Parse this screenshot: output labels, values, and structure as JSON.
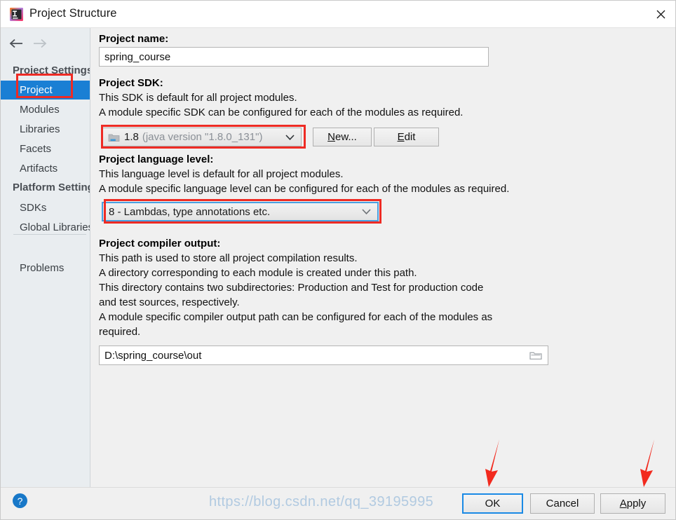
{
  "window": {
    "title": "Project Structure",
    "app_icon": "intellij-idea-icon",
    "close_label": "✕"
  },
  "sidebar": {
    "back_icon": "arrow-left-icon",
    "forward_icon": "arrow-right-icon",
    "groups": [
      {
        "label": "Project Settings"
      },
      {
        "label": "Platform Settings"
      }
    ],
    "items": [
      {
        "label": "Project",
        "selected": true
      },
      {
        "label": "Modules",
        "selected": false
      },
      {
        "label": "Libraries",
        "selected": false
      },
      {
        "label": "Facets",
        "selected": false
      },
      {
        "label": "Artifacts",
        "selected": false
      },
      {
        "label": "SDKs",
        "selected": false
      },
      {
        "label": "Global Libraries",
        "selected": false
      },
      {
        "label": "Problems",
        "selected": false
      }
    ]
  },
  "main": {
    "project_name": {
      "title": "Project name:",
      "value": "spring_course"
    },
    "project_sdk": {
      "title": "Project SDK:",
      "line1": "This SDK is default for all project modules.",
      "line2": "A module specific SDK can be configured for each of the modules as required.",
      "selected_name": "1.8",
      "selected_detail": "(java version \"1.8.0_131\")",
      "sdk_icon": "jdk-folder-icon",
      "dropdown_icon": "chevron-down-icon",
      "new_button": "New...",
      "new_button_mnemonic": "N",
      "edit_button": "Edit",
      "edit_button_mnemonic": "E"
    },
    "language_level": {
      "title": "Project language level:",
      "line1": "This language level is default for all project modules.",
      "line2": "A module specific language level can be configured for each of the modules as required.",
      "value": "8 - Lambdas, type annotations etc.",
      "dropdown_icon": "chevron-down-icon"
    },
    "compiler_output": {
      "title": "Project compiler output:",
      "line1": "This path is used to store all project compilation results.",
      "line2": "A directory corresponding to each module is created under this path.",
      "line3": "This directory contains two subdirectories: Production and Test for production code",
      "line4": "and test sources, respectively.",
      "line5": "A module specific compiler output path can be configured for each of the modules as",
      "line6": "required.",
      "value": "D:\\spring_course\\out",
      "browse_icon": "folder-icon"
    }
  },
  "footer": {
    "help_icon": "help-question-icon",
    "help_label": "?",
    "ok_label": "OK",
    "cancel_label": "Cancel",
    "apply_label": "Apply",
    "apply_mnemonic": "A"
  },
  "annotations": {
    "watermark": "https://blog.csdn.net/qq_39195995",
    "highlight_color": "#ee2b24",
    "boxes": [
      {
        "name": "sidebar-project-highlight"
      },
      {
        "name": "project-sdk-highlight"
      },
      {
        "name": "language-level-highlight"
      }
    ],
    "arrows": [
      {
        "name": "ok-button-arrow"
      },
      {
        "name": "apply-button-arrow"
      }
    ]
  },
  "colors": {
    "selection_blue": "#1a7fd4",
    "focus_blue": "#1a8ae5",
    "annotation_red": "#ee2b24",
    "help_blue": "#1878c8"
  }
}
